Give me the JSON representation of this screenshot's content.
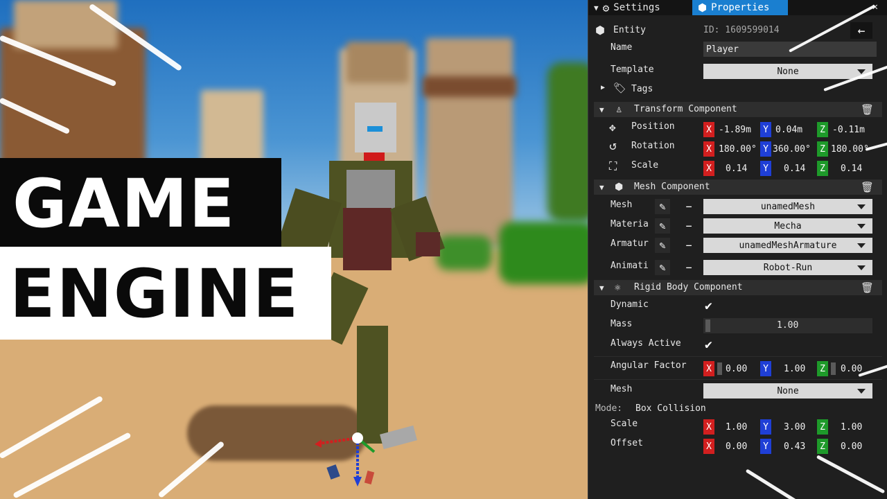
{
  "thumbnail": {
    "line1": "GAME",
    "line2": "ENGINE"
  },
  "tabs": {
    "settings": "Settings",
    "properties": "Properties",
    "close": "✕"
  },
  "entity": {
    "label": "Entity",
    "id": "ID: 1609599014",
    "back": "←"
  },
  "name": {
    "label": "Name",
    "value": "Player"
  },
  "template": {
    "label": "Template",
    "value": "None"
  },
  "tags": {
    "label": "Tags"
  },
  "transform": {
    "title": "Transform Component",
    "position": {
      "label": "Position",
      "x": "-1.89m",
      "y": "0.04m",
      "z": "-0.11m"
    },
    "rotation": {
      "label": "Rotation",
      "x": "180.00°",
      "y": "360.00°",
      "z": "180.00°"
    },
    "scale": {
      "label": "Scale",
      "x": "0.14",
      "y": "0.14",
      "z": "0.14"
    }
  },
  "mesh_component": {
    "title": "Mesh Component",
    "mesh": {
      "label": "Mesh",
      "value": "unamedMesh"
    },
    "material": {
      "label": "Materia",
      "value": "Mecha"
    },
    "armature": {
      "label": "Armatur",
      "value": "unamedMeshArmature"
    },
    "animation": {
      "label": "Animati",
      "value": "Robot-Run"
    }
  },
  "rigid_body": {
    "title": "Rigid Body Component",
    "dynamic": {
      "label": "Dynamic",
      "checked": true
    },
    "mass": {
      "label": "Mass",
      "value": "1.00"
    },
    "always_active": {
      "label": "Always Active",
      "checked": true
    },
    "angular_factor": {
      "label": "Angular Factor",
      "x": "0.00",
      "y": "1.00",
      "z": "0.00"
    },
    "mesh": {
      "label": "Mesh",
      "value": "None"
    },
    "mode": {
      "label": "Mode:",
      "value": "Box Collision"
    },
    "scale": {
      "label": "Scale",
      "x": "1.00",
      "y": "3.00",
      "z": "1.00"
    },
    "offset": {
      "label": "Offset",
      "x": "0.00",
      "y": "0.43",
      "z": "0.00"
    }
  },
  "axes": {
    "x": "X",
    "y": "Y",
    "z": "Z"
  },
  "colors": {
    "accent": "#1a7fd0",
    "axis_x": "#d21f1f",
    "axis_y": "#1f3fd6",
    "axis_z": "#1e9a2a",
    "panel_bg": "#1f1f1f"
  }
}
